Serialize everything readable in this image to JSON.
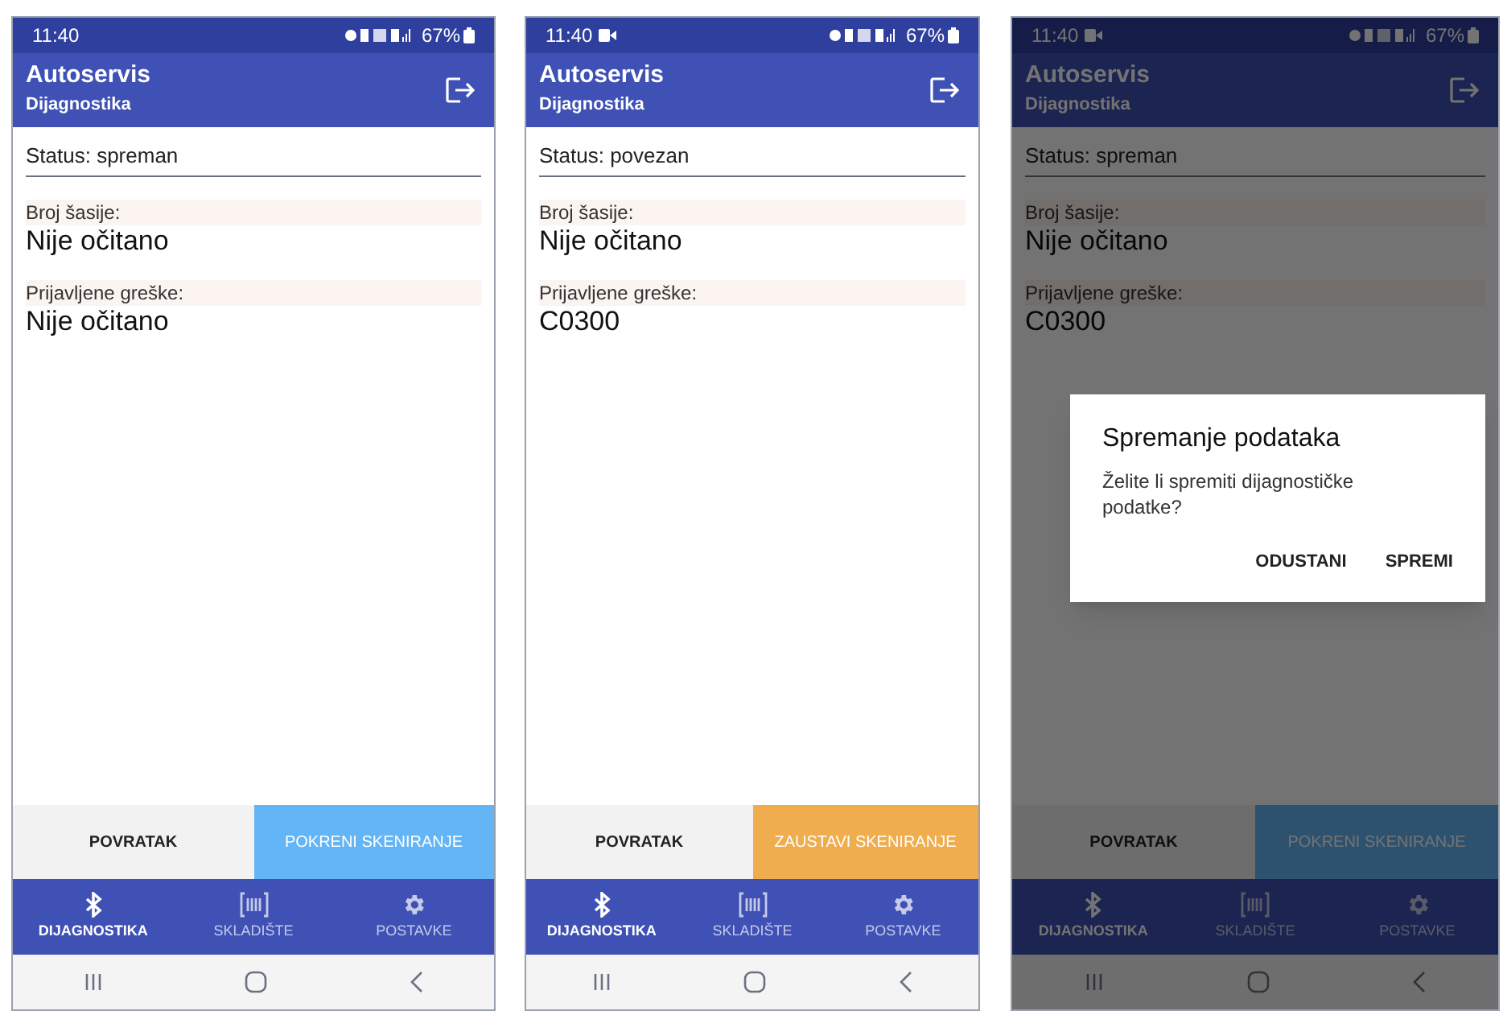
{
  "phones": [
    {
      "time": "11:40",
      "screen_recording": false,
      "battery": "67%",
      "app_title": "Autoservis",
      "app_subtitle": "Dijagnostika",
      "status": "Status: spreman",
      "fields": [
        {
          "label": "Broj šasije:",
          "value": "Nije očitano"
        },
        {
          "label": "Prijavljene greške:",
          "value": "Nije očitano"
        }
      ],
      "back_button": "POVRATAK",
      "scan_button": {
        "label": "POKRENI SKENIRANJE",
        "kind": "start"
      },
      "nav": [
        {
          "label": "DIJAGNOSTIKA",
          "selected": true
        },
        {
          "label": "SKLADIŠTE",
          "selected": false
        },
        {
          "label": "POSTAVKE",
          "selected": false
        }
      ]
    },
    {
      "time": "11:40",
      "screen_recording": true,
      "battery": "67%",
      "app_title": "Autoservis",
      "app_subtitle": "Dijagnostika",
      "status": "Status: povezan",
      "fields": [
        {
          "label": "Broj šasije:",
          "value": "Nije očitano"
        },
        {
          "label": "Prijavljene greške:",
          "value": "C0300"
        }
      ],
      "back_button": "POVRATAK",
      "scan_button": {
        "label": "ZAUSTAVI SKENIRANJE",
        "kind": "stop"
      },
      "nav": [
        {
          "label": "DIJAGNOSTIKA",
          "selected": true
        },
        {
          "label": "SKLADIŠTE",
          "selected": false
        },
        {
          "label": "POSTAVKE",
          "selected": false
        }
      ]
    },
    {
      "time": "11:40",
      "screen_recording": true,
      "battery": "67%",
      "app_title": "Autoservis",
      "app_subtitle": "Dijagnostika",
      "status": "Status: spreman",
      "fields": [
        {
          "label": "Broj šasije:",
          "value": "Nije očitano"
        },
        {
          "label": "Prijavljene greške:",
          "value": "C0300"
        }
      ],
      "back_button": "POVRATAK",
      "scan_button": {
        "label": "POKRENI SKENIRANJE",
        "kind": "start"
      },
      "nav": [
        {
          "label": "DIJAGNOSTIKA",
          "selected": true
        },
        {
          "label": "SKLADIŠTE",
          "selected": false
        },
        {
          "label": "POSTAVKE",
          "selected": false
        }
      ],
      "dialog": {
        "title": "Spremanje podataka",
        "message": "Želite li spremiti dijagnostičke podatke?",
        "buttons": [
          "ODUSTANI",
          "SPREMI"
        ]
      }
    }
  ]
}
